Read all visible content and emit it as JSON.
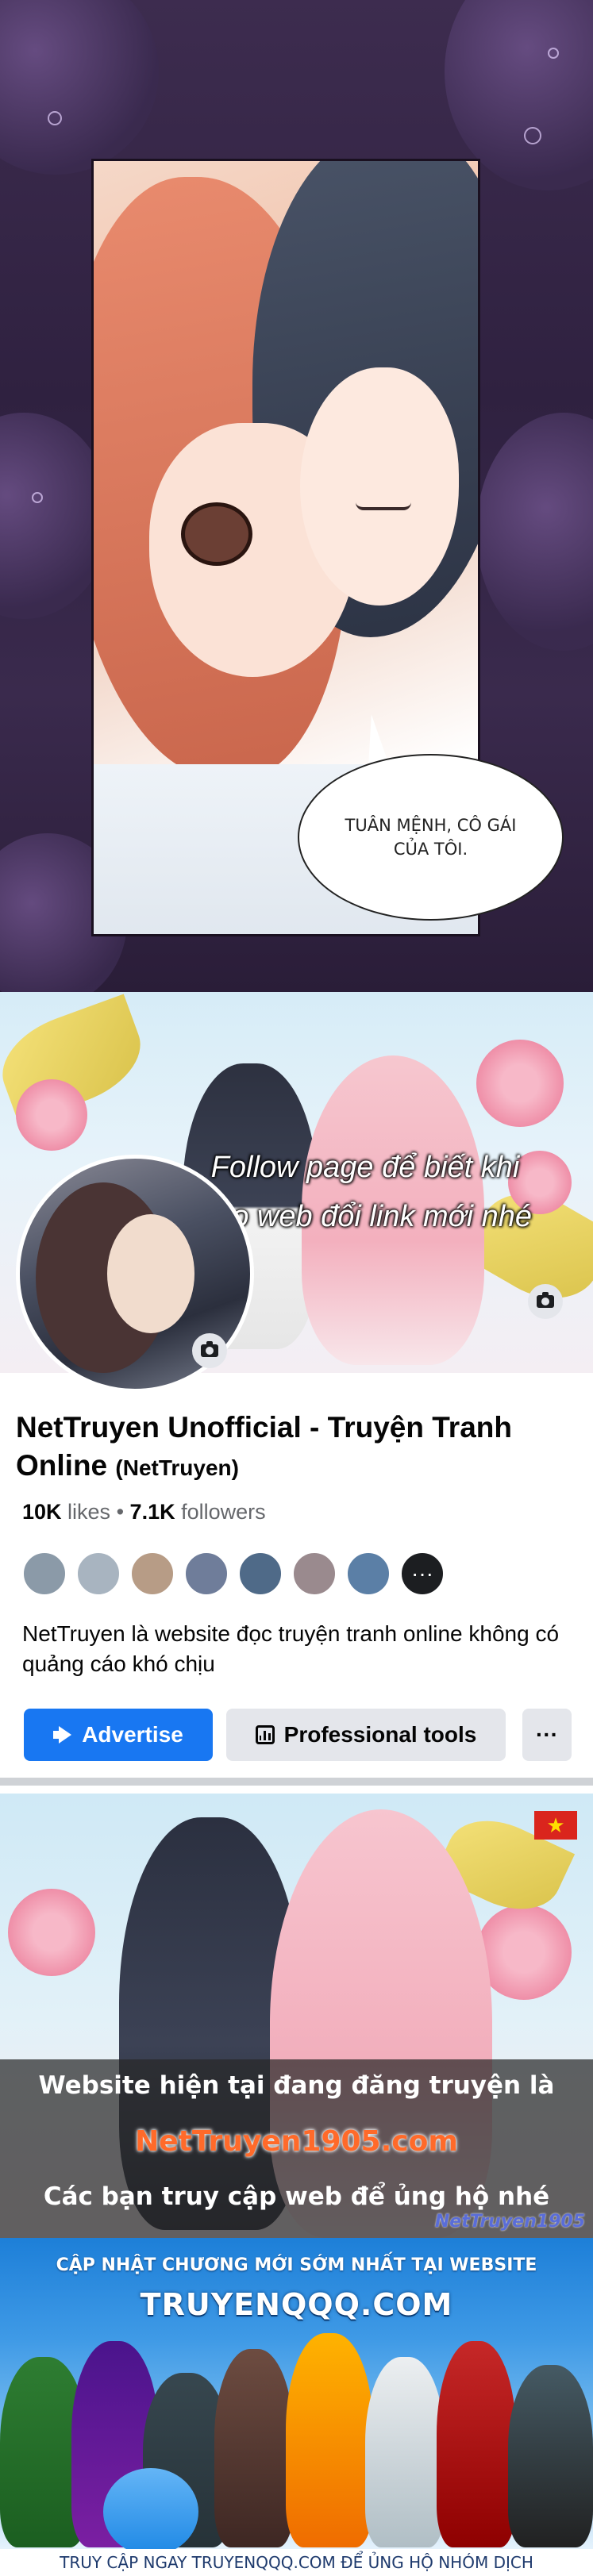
{
  "manga": {
    "speech_bubble": "TUÂN MỆNH, CÔ GÁI\nCỦA TÔI."
  },
  "facebook_page": {
    "cover_caption_line1": "Follow page để biết khi",
    "cover_caption_line2": "nào web đổi link mới nhé",
    "name": "NetTruyen Unofficial - Truyện Tranh Online",
    "handle": "(NetTruyen)",
    "likes_count": "10K",
    "likes_label": "likes",
    "followers_count": "7.1K",
    "followers_label": "followers",
    "more_friends": "···",
    "about": "NetTruyen là website đọc truyện tranh online không có quảng cáo khó chịu",
    "buttons": {
      "advertise": "Advertise",
      "professional_tools": "Professional tools",
      "more": "···"
    },
    "icons": [
      "camera-icon",
      "megaphone-icon",
      "bar-chart-icon",
      "more-icon"
    ]
  },
  "site_banner": {
    "line1": "Website hiện tại đang đăng truyện là",
    "domain": "NetTruyen1905.com",
    "line3": "Các bạn truy cập web để ủng hộ nhé",
    "watermark": "NetTruyen1905",
    "flag_star": "★"
  },
  "qqq_banner": {
    "headline": "CẬP NHẬT CHƯƠNG MỚI SỚM NHẤT TẠI WEBSITE",
    "logo": "TRUYENQQQ.COM",
    "footer": "TRUY CẬP NGAY TRUYENQQQ.COM ĐỂ ỦNG HỘ NHÓM DỊCH"
  },
  "colors": {
    "facebook_blue": "#1877f2",
    "button_grey": "#e4e6eb",
    "text_primary": "#050505",
    "text_secondary": "#65676b",
    "domain_orange": "#ff6a2a"
  }
}
